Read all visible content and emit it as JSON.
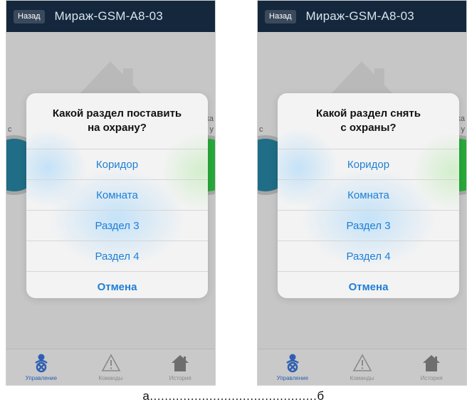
{
  "screens": [
    {
      "back_label": "Назад",
      "title": "Мираж-GSM-A8-03",
      "left_text": "c",
      "right_text_1": "ка",
      "right_text_2": "у",
      "dialog": {
        "title": "Какой раздел поставить\nна охрану?",
        "options": [
          "Коридор",
          "Комната",
          "Раздел 3",
          "Раздел 4"
        ],
        "cancel": "Отмена"
      },
      "tabs": [
        {
          "label": "Управление",
          "icon": "control-icon",
          "active": true
        },
        {
          "label": "Команды",
          "icon": "warning-icon",
          "active": false
        },
        {
          "label": "История",
          "icon": "house-icon",
          "active": false
        }
      ]
    },
    {
      "back_label": "Назад",
      "title": "Мираж-GSM-A8-03",
      "left_text": "c",
      "right_text_1": "ка",
      "right_text_2": "у",
      "dialog": {
        "title": "Какой раздел снять\nс охраны?",
        "options": [
          "Коридор",
          "Комната",
          "Раздел 3",
          "Раздел 4"
        ],
        "cancel": "Отмена"
      },
      "tabs": [
        {
          "label": "Управление",
          "icon": "control-icon",
          "active": true
        },
        {
          "label": "Команды",
          "icon": "warning-icon",
          "active": false
        },
        {
          "label": "История",
          "icon": "house-icon",
          "active": false
        }
      ]
    }
  ],
  "caption": "а.............................................б",
  "colors": {
    "topbar": "#14273c",
    "accent_blue": "#1e7fd6",
    "armed_green": "#28a83a",
    "teal": "#1f6d86"
  }
}
